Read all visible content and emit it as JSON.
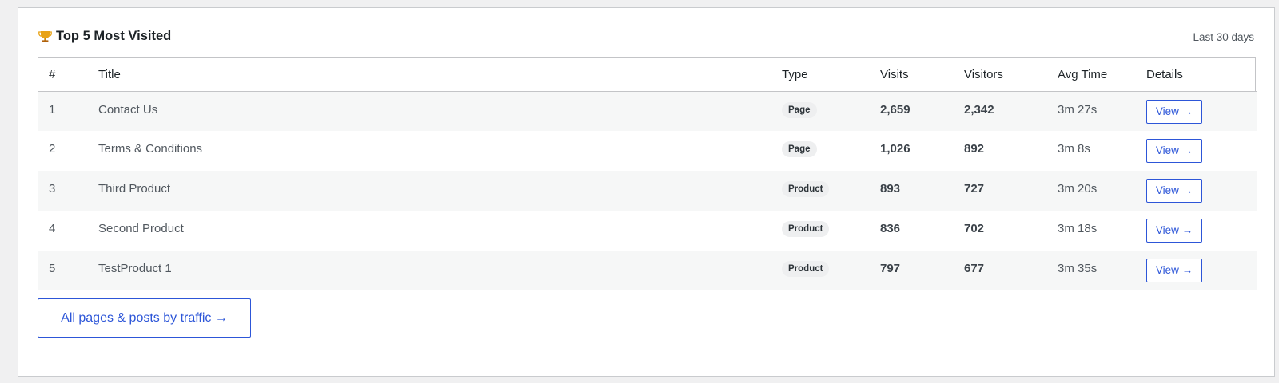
{
  "header": {
    "title": "Top 5 Most Visited",
    "range": "Last 30 days",
    "icon": "trophy-icon"
  },
  "table": {
    "columns": [
      "#",
      "Title",
      "Type",
      "Visits",
      "Visitors",
      "Avg Time",
      "Details"
    ],
    "rows": [
      {
        "rank": "1",
        "title": "Contact Us",
        "type": "Page",
        "visits": "2,659",
        "visitors": "2,342",
        "avg_time": "3m 27s",
        "details": "View →"
      },
      {
        "rank": "2",
        "title": "Terms & Conditions",
        "type": "Page",
        "visits": "1,026",
        "visitors": "892",
        "avg_time": "3m 8s",
        "details": "View →"
      },
      {
        "rank": "3",
        "title": "Third Product",
        "type": "Product",
        "visits": "893",
        "visitors": "727",
        "avg_time": "3m 20s",
        "details": "View →"
      },
      {
        "rank": "4",
        "title": "Second Product",
        "type": "Product",
        "visits": "836",
        "visitors": "702",
        "avg_time": "3m 18s",
        "details": "View →"
      },
      {
        "rank": "5",
        "title": "TestProduct 1",
        "type": "Product",
        "visits": "797",
        "visitors": "677",
        "avg_time": "3m 35s",
        "details": "View →"
      }
    ]
  },
  "footer": {
    "all_pages_label": "All pages & posts by traffic →"
  },
  "colors": {
    "accent": "#2d56d8",
    "row_alt": "#f6f7f7",
    "badge_bg": "#eeeff0"
  }
}
